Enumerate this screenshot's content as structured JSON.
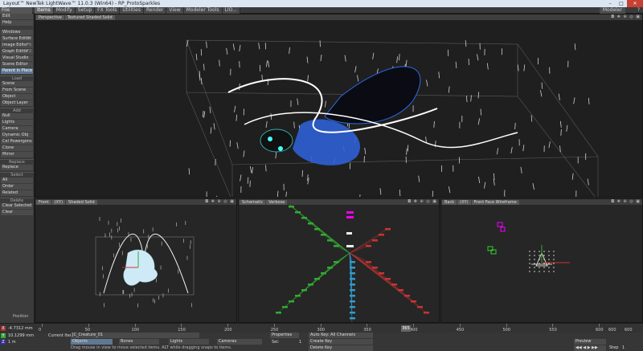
{
  "window": {
    "title": "Layout™ NewTek LightWave™ 11.0.3 (Win64) - RP_ProtoSparkles",
    "controls": [
      "–",
      "□",
      "✕"
    ]
  },
  "menubar": {
    "file": "File",
    "tabs": [
      "Items",
      "Modify",
      "Setup",
      "FX Tools",
      "Utilities",
      "Render",
      "View",
      "Modeler Tools",
      "LIO..."
    ],
    "active_tab": 0,
    "modeler": "Modeler",
    "help_icon": "?"
  },
  "sidebar": {
    "top": [
      {
        "label": "Edit",
        "key": ""
      },
      {
        "label": "Help",
        "key": ""
      }
    ],
    "windows_label": "Windows",
    "windows_items": [
      {
        "label": "Surface Editor",
        "key": "F5"
      },
      {
        "label": "Image Editor",
        "key": "F6"
      },
      {
        "label": "Graph Editor",
        "key": "^F2"
      },
      {
        "label": "Visual Studio",
        "key": ""
      },
      {
        "label": "Scene Editor",
        "key": ""
      }
    ],
    "parent_in_place": "Parent in Place",
    "load_label": "Load",
    "load_items": [
      "Scene",
      "From Scene",
      "Object",
      "Object Layer"
    ],
    "add_label": "Add",
    "add_items": [
      "Null",
      "Lights",
      "Camera",
      "Dynamic Obj",
      "Cel Powergons",
      "Clone",
      "Mirror"
    ],
    "replace_label": "Replace",
    "replace_items": [
      "Replace"
    ],
    "select_label": "Select",
    "select_items": [
      "All",
      "Order",
      "Related"
    ],
    "delete_label": "Delete",
    "delete_items": [
      "Clear Selected",
      "Clear"
    ]
  },
  "viewports": {
    "top": {
      "view": "Perspective",
      "shading": "Textured Shaded Solid"
    },
    "bl": {
      "view": "Front",
      "axis": "(XY)",
      "shading": "Shaded Solid"
    },
    "bm": {
      "view": "Schematic",
      "shading": "Verbose"
    },
    "br": {
      "view": "Back",
      "axis": "(XY)",
      "shading": "Front Face Wireframe"
    }
  },
  "timeline": {
    "ticks": [
      "0",
      "50",
      "100",
      "150",
      "200",
      "250",
      "300",
      "350",
      "400",
      "450",
      "500",
      "550",
      "600"
    ],
    "current_frame": "365",
    "end_frames": [
      "600",
      "600"
    ]
  },
  "position": {
    "label": "Position",
    "x": "-4.7312 mm",
    "y": "1 m",
    "z": "10.1299 mm",
    "grid": "1 m"
  },
  "bottom": {
    "current_item_label": "Current Item",
    "current_item": "JC_Creature_01",
    "objects": "Objects",
    "bones": "Bones",
    "lights": "Lights",
    "cameras": "Cameras",
    "properties": "Properties",
    "sel_label": "Sel:",
    "sel_value": "1",
    "auto_key": "Auto Key: All Channels",
    "create_key": "Create Key",
    "delete_key": "Delete Key",
    "preview": "Preview",
    "step_label": "Step",
    "step_value": "1",
    "hint": "Drag mouse in view to move selected items. ALT while dragging snaps to items."
  },
  "colors": {
    "accent": "#5f7893",
    "creature_blue": "#2d5fd4",
    "close_red": "#c84031"
  }
}
